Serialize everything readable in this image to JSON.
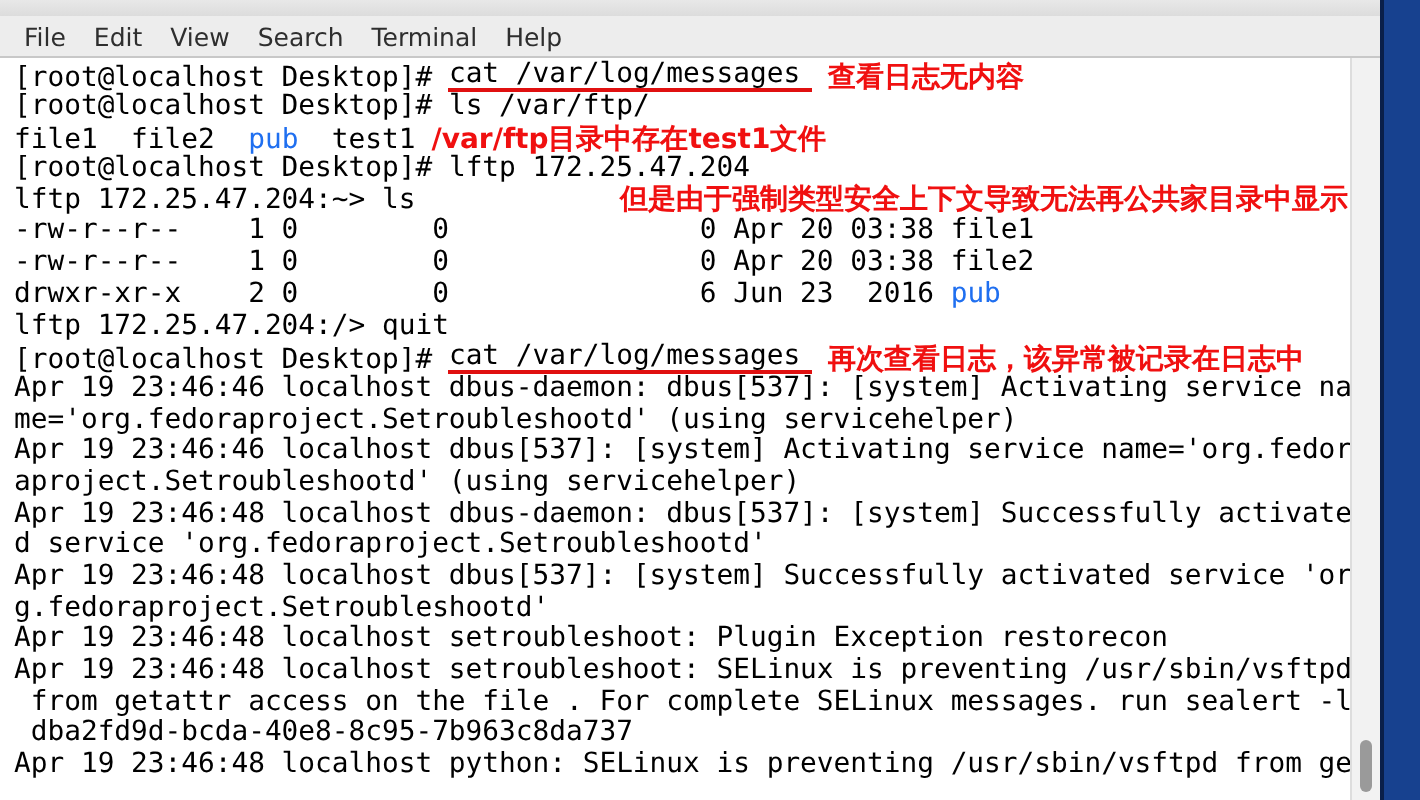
{
  "menu": [
    "File",
    "Edit",
    "View",
    "Search",
    "Terminal",
    "Help"
  ],
  "lines": [
    {
      "segments": [
        {
          "kind": "prompt",
          "text": "[root@localhost Desktop]#"
        },
        {
          "kind": "command",
          "text": "cat /var/log/messages",
          "underlined": true
        }
      ],
      "note": {
        "kind": "inline",
        "text": "查看日志无内容"
      }
    },
    {
      "segments": [
        {
          "kind": "prompt",
          "text": "[root@localhost Desktop]#"
        },
        {
          "kind": "command",
          "text": "ls /var/ftp/",
          "underlined": false
        }
      ]
    },
    {
      "segments": [
        {
          "kind": "plain",
          "text": "file1  file2  "
        },
        {
          "kind": "dir",
          "text": "pub"
        },
        {
          "kind": "plain",
          "text": "  test1"
        }
      ],
      "note": {
        "kind": "inline",
        "text": "/var/ftp目录中存在test1文件"
      }
    },
    {
      "segments": [
        {
          "kind": "prompt",
          "text": "[root@localhost Desktop]#"
        },
        {
          "kind": "command",
          "text": "lftp 172.25.47.204",
          "underlined": false
        }
      ]
    },
    {
      "segments": [
        {
          "kind": "plain",
          "text": "lftp 172.25.47.204:~> ls"
        }
      ],
      "note": {
        "kind": "below",
        "text": "但是由于强制类型安全上下文导致无法再公共家目录中显示"
      }
    },
    {
      "segments": [
        {
          "kind": "plain",
          "text": "-rw-r--r--    1 0        0               0 Apr 20 03:38 file1"
        }
      ]
    },
    {
      "segments": [
        {
          "kind": "plain",
          "text": "-rw-r--r--    1 0        0               0 Apr 20 03:38 file2"
        }
      ]
    },
    {
      "segments": [
        {
          "kind": "plain",
          "text": "drwxr-xr-x    2 0        0               6 Jun 23  2016 "
        },
        {
          "kind": "dir",
          "text": "pub"
        }
      ]
    },
    {
      "segments": [
        {
          "kind": "plain",
          "text": "lftp 172.25.47.204:/> quit"
        }
      ]
    },
    {
      "segments": [
        {
          "kind": "prompt",
          "text": "[root@localhost Desktop]#"
        },
        {
          "kind": "command",
          "text": "cat /var/log/messages",
          "underlined": true
        }
      ],
      "note": {
        "kind": "inline",
        "text": "再次查看日志，该异常被记录在日志中"
      }
    },
    {
      "segments": [
        {
          "kind": "plain",
          "text": "Apr 19 23:46:46 localhost dbus-daemon: dbus[537]: [system] Activating service na"
        }
      ]
    },
    {
      "segments": [
        {
          "kind": "plain",
          "text": "me='org.fedoraproject.Setroubleshootd' (using servicehelper)"
        }
      ]
    },
    {
      "segments": [
        {
          "kind": "plain",
          "text": "Apr 19 23:46:46 localhost dbus[537]: [system] Activating service name='org.fedor"
        }
      ]
    },
    {
      "segments": [
        {
          "kind": "plain",
          "text": "aproject.Setroubleshootd' (using servicehelper)"
        }
      ]
    },
    {
      "segments": [
        {
          "kind": "plain",
          "text": "Apr 19 23:46:48 localhost dbus-daemon: dbus[537]: [system] Successfully activate"
        }
      ]
    },
    {
      "segments": [
        {
          "kind": "plain",
          "text": "d service 'org.fedoraproject.Setroubleshootd'"
        }
      ]
    },
    {
      "segments": [
        {
          "kind": "plain",
          "text": "Apr 19 23:46:48 localhost dbus[537]: [system] Successfully activated service 'or"
        }
      ]
    },
    {
      "segments": [
        {
          "kind": "plain",
          "text": "g.fedoraproject.Setroubleshootd'"
        }
      ]
    },
    {
      "segments": [
        {
          "kind": "plain",
          "text": "Apr 19 23:46:48 localhost setroubleshoot: Plugin Exception restorecon"
        }
      ]
    },
    {
      "segments": [
        {
          "kind": "plain",
          "text": "Apr 19 23:46:48 localhost setroubleshoot: SELinux is preventing /usr/sbin/vsftpd"
        }
      ]
    },
    {
      "segments": [
        {
          "kind": "plain",
          "text": " from getattr access on the file . For complete SELinux messages. run sealert -l"
        }
      ]
    },
    {
      "segments": [
        {
          "kind": "plain",
          "text": " dba2fd9d-bcda-40e8-8c95-7b963c8da737"
        }
      ]
    },
    {
      "segments": [
        {
          "kind": "plain",
          "text": "Apr 19 23:46:48 localhost python: SELinux is preventing /usr/sbin/vsftpd from ge"
        }
      ]
    }
  ]
}
